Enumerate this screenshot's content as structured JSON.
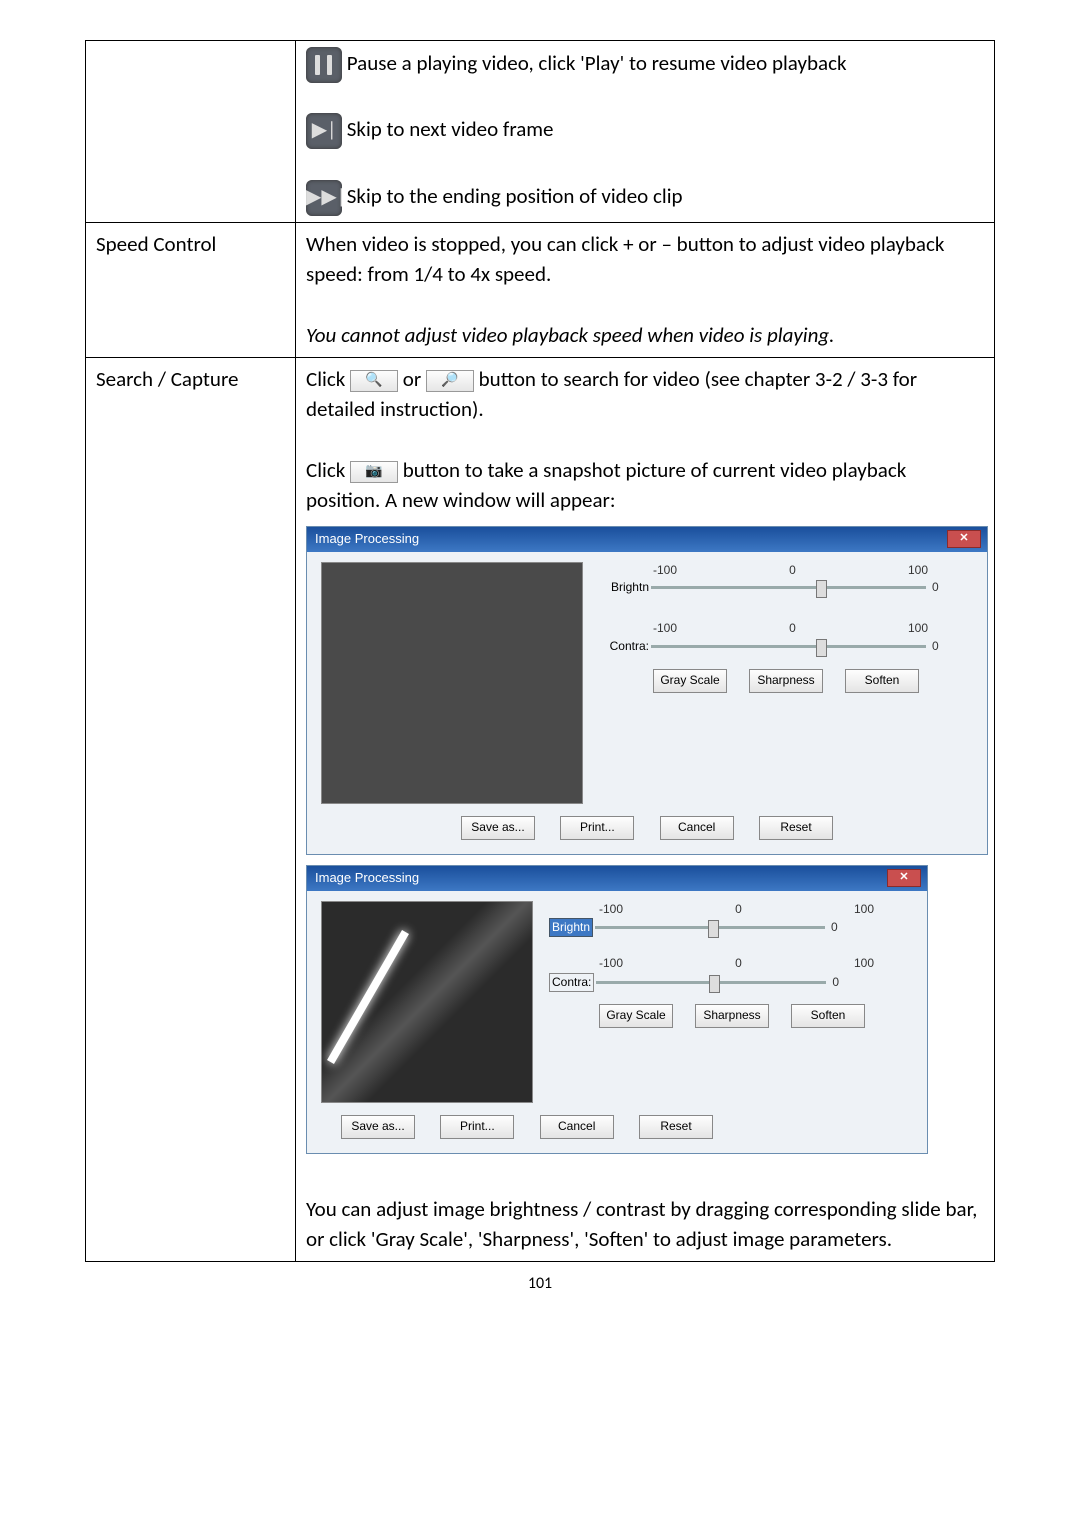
{
  "row1": {
    "pause_text": " Pause a playing video, click 'Play' to resume video playback",
    "next_text": " Skip to next video frame",
    "end_text": " Skip to the ending position of video clip"
  },
  "row2": {
    "label": "Speed Control",
    "line1": "When video is stopped, you can click + or – button to adjust video playback speed: from 1/4 to 4x speed.",
    "line2": "You cannot adjust video playback speed when video is playing."
  },
  "row3": {
    "label": "Search / Capture",
    "click": "Click ",
    "or": " or ",
    "search_tail": " button to search for video (see chapter 3-2 / 3-3 for detailed instruction).",
    "snap_tail": " button to take a snapshot picture of current video playback position. A new window will appear:",
    "footer": "You can adjust image brightness / contrast by dragging corresponding slide bar, or click 'Gray Scale', 'Sharpness', 'Soften' to adjust image parameters."
  },
  "dlg": {
    "title": "Image Processing",
    "close": "✕",
    "min": "-100",
    "zero": "0",
    "max": "100",
    "bright": "Brightn",
    "contra": "Contra:",
    "valB1": "0",
    "valC1": "0",
    "valB2": "0",
    "valC2": "0",
    "gray": "Gray Scale",
    "sharp": "Sharpness",
    "soft": "Soften",
    "save": "Save as...",
    "print": "Print...",
    "cancel": "Cancel",
    "reset": "Reset"
  },
  "page_number": "101"
}
